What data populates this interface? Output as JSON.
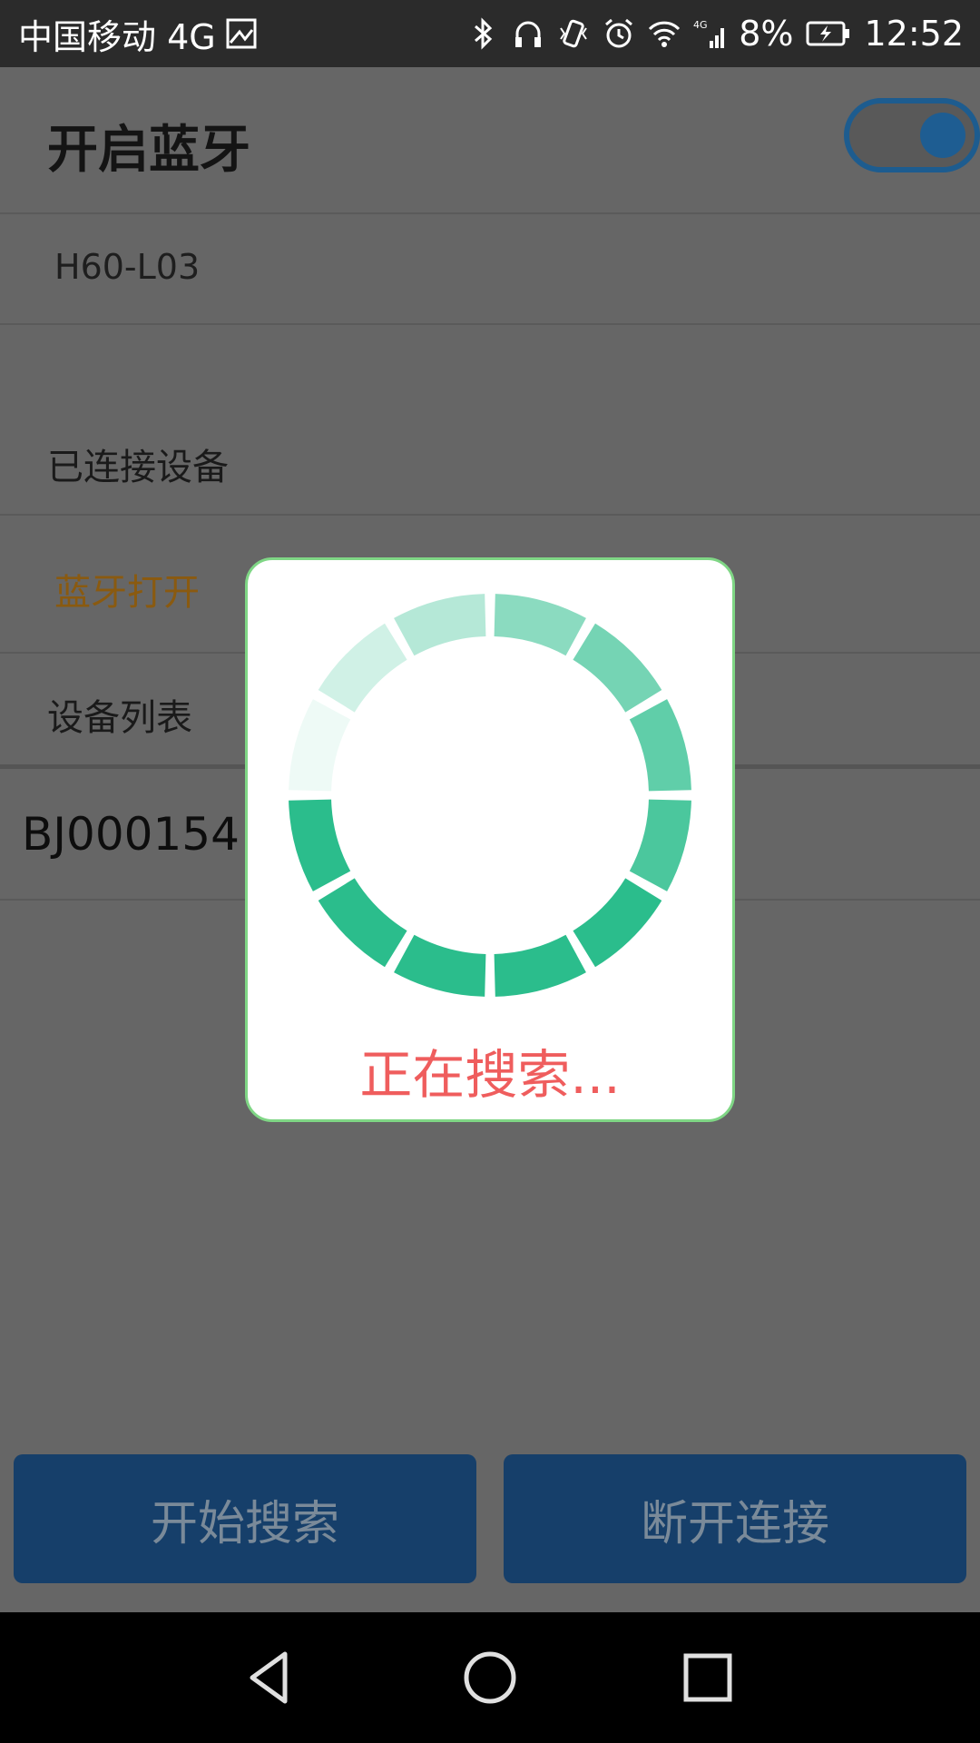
{
  "status_bar": {
    "carrier": "中国移动 4G",
    "network_type": "4G",
    "battery": "8%",
    "time": "12:52",
    "icons": [
      "image-icon",
      "bluetooth-icon",
      "headphones-icon",
      "vibrate-icon",
      "alarm-icon",
      "wifi-icon",
      "signal-icon",
      "battery-charging-icon"
    ]
  },
  "header": {
    "title": "开启蓝牙",
    "toggle_on": true
  },
  "local_device": {
    "name": "H60-L03"
  },
  "connected_section": {
    "label": "已连接设备"
  },
  "bluetooth_status": {
    "text": "蓝牙打开"
  },
  "device_list": {
    "label": "设备列表",
    "items": [
      "BJ000154"
    ]
  },
  "buttons": {
    "start_search": "开始搜索",
    "disconnect": "断开连接"
  },
  "dialog": {
    "message": "正在搜索..."
  },
  "colors": {
    "accent_blue": "#1e5d92",
    "spinner_green": "#2bbd8c",
    "dialog_text": "#ef5d5d",
    "status_text": "#8a5a10"
  }
}
